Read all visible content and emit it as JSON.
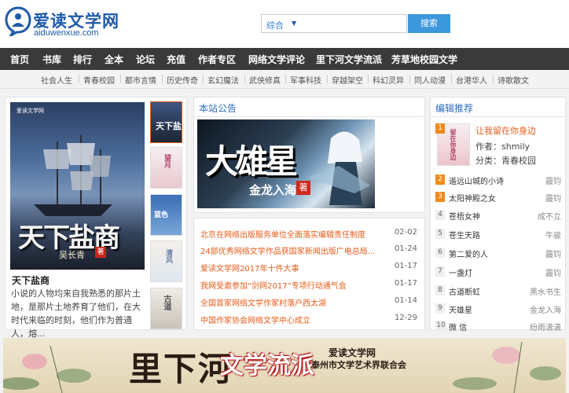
{
  "header": {
    "site_name": "爱读文学网",
    "domain": "aiduwenxue.com",
    "search_select": "综合",
    "search_button": "搜索"
  },
  "nav": [
    "首页",
    "书库",
    "排行",
    "全本",
    "论坛",
    "充值",
    "作者专区",
    "网络文学评论",
    "里下河文学流派",
    "芳草地校园文学"
  ],
  "subnav": [
    "社会人生",
    "青春校园",
    "都市言情",
    "历史传奇",
    "玄幻魔法",
    "武侠修真",
    "军事科技",
    "穿越架空",
    "科幻灵异",
    "同人动漫",
    "台港华人",
    "诗歌散文"
  ],
  "featured": {
    "cover_site": "爱读文学网",
    "cover_title": "天下盐商",
    "cover_author": "吴长青",
    "seal": "著",
    "title": "天下盐商",
    "description": "小说的人物均来自我熟悉的那片土地，是那片土地养育了他们，在大时代来临的时刻，他们作为普通人，熔..."
  },
  "notice": {
    "title": "本站公告",
    "banner_title": "大雄星",
    "banner_author": "金龙入海",
    "banner_seal": "著",
    "news": [
      {
        "title": "北京在网络出版服务单位全面落实编辑责任制度",
        "date": "02-02"
      },
      {
        "title": "24部优秀网络文学作品获国家新闻出版广电总局...",
        "date": "01-24"
      },
      {
        "title": "爱读文学网2017年十件大事",
        "date": "01-17"
      },
      {
        "title": "我网受邀参加“剑网2017”专项行动通气会",
        "date": "01-17"
      },
      {
        "title": "全国首家网络文学作家村落户西太湖",
        "date": "01-14"
      },
      {
        "title": "中国作家协会网络文学中心成立",
        "date": "12-29"
      }
    ]
  },
  "editor_picks": {
    "title": "编辑推荐",
    "top": {
      "title": "让我留在你身边",
      "author": "作者：shmily",
      "category": "分类：青春校园"
    },
    "list": [
      {
        "num": "2",
        "title": "遥远山城的小诗",
        "author": "霾钧"
      },
      {
        "num": "3",
        "title": "太阳神殿之女",
        "author": "霾钧"
      },
      {
        "num": "4",
        "title": "苍梧女神",
        "author": "成不立"
      },
      {
        "num": "5",
        "title": "苍生天路",
        "author": "牛骏"
      },
      {
        "num": "6",
        "title": "第二爱的人",
        "author": "霾钧"
      },
      {
        "num": "7",
        "title": "一盏灯",
        "author": "霾钧"
      },
      {
        "num": "8",
        "title": "古道断虹",
        "author": "黑水书生"
      },
      {
        "num": "9",
        "title": "天雄星",
        "author": "金龙入海"
      },
      {
        "num": "10",
        "title": "微 信",
        "author": "纷雨潇潇"
      }
    ]
  },
  "bottom_banner": {
    "big": "里下河",
    "red": "文学流派",
    "line1": "爱读文学网",
    "line2": "泰州市文学艺术界联合会"
  },
  "colors": {
    "accent": "#3c97dd",
    "nav_bg": "#3a3a3a",
    "link_orange": "#e65b1a",
    "rank_highlight": "#f08a1c"
  }
}
